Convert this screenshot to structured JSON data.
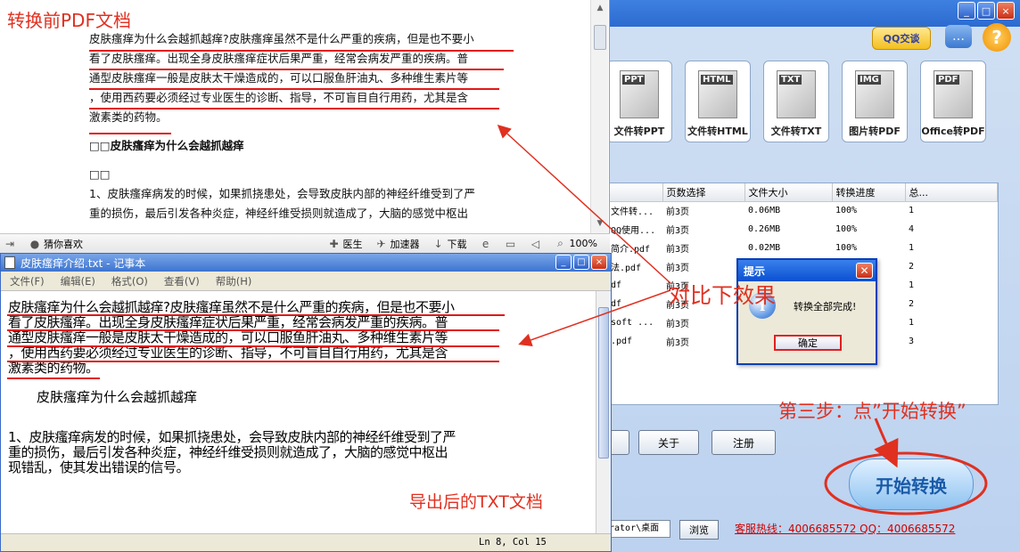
{
  "pdf": {
    "heading": "转换前PDF文档",
    "lines": [
      "皮肤瘙痒为什么会越抓越痒?皮肤瘙痒虽然不是什么严重的疾病，但是也不要小",
      "看了皮肤瘙痒。出现全身皮肤瘙痒症状后果严重，经常会病发严重的疾病。普",
      "通型皮肤瘙痒一般是皮肤太干燥造成的，可以口服鱼肝油丸、多种维生素片等",
      "，使用西药要必须经过专业医生的诊断、指导，不可盲目自行用药，尤其是含",
      "激素类的药物。"
    ],
    "subheading": "□□皮肤瘙痒为什么会越抓越痒",
    "squares": "□□",
    "para_line1": "1、皮肤瘙痒病发的时候，如果抓挠患处，会导致皮肤内部的神经纤维受到了严",
    "para_line2": "重的损伤，最后引发各种炎症，神经纤维受损则就造成了，大脑的感觉中枢出",
    "status": {
      "fav": "猜你喜欢",
      "doctor": "医生",
      "accelerator": "加速器",
      "download": "下载",
      "zoom": "100%"
    }
  },
  "notepad": {
    "title": "皮肤瘙痒介绍.txt - 记事本",
    "menu": [
      "文件(F)",
      "编辑(E)",
      "格式(O)",
      "查看(V)",
      "帮助(H)"
    ],
    "lines": [
      "皮肤瘙痒为什么会越抓越痒?皮肤瘙痒虽然不是什么严重的疾病，但是也不要小",
      "看了皮肤瘙痒。出现全身皮肤瘙痒症状后果严重，经常会病发严重的疾病。普",
      "通型皮肤瘙痒一般是皮肤太干燥造成的，可以口服鱼肝油丸、多种维生素片等",
      "，使用西药要必须经过专业医生的诊断、指导，不可盲目自行用药，尤其是含",
      "激素类的药物。"
    ],
    "heading": "皮肤瘙痒为什么会越抓越痒",
    "para": [
      "1、皮肤瘙痒病发的时候，如果抓挠患处，会导致皮肤内部的神经纤维受到了严",
      "重的损伤，最后引发各种炎症，神经纤维受损则就造成了，大脑的感觉中枢出",
      "现错乱，使其发出错误的信号。"
    ],
    "status_pos": "Ln 8, Col 15",
    "label": "导出后的TXT文档"
  },
  "app": {
    "qq_button": "QQ交谈",
    "tools": [
      {
        "tag": "PPT",
        "label": "文件转PPT"
      },
      {
        "tag": "HTML",
        "label": "文件转HTML"
      },
      {
        "tag": "TXT",
        "label": "文件转TXT"
      },
      {
        "tag": "IMG",
        "label": "图片转PDF"
      },
      {
        "tag": "PDF",
        "label": "Office转PDF"
      }
    ],
    "table": {
      "headers": [
        "",
        "页数选择",
        "文件大小",
        "转换进度",
        "总..."
      ],
      "rows": [
        [
          "文件转...",
          "前3页",
          "0.06MB",
          "100%",
          "1"
        ],
        [
          "QQ使用...",
          "前3页",
          "0.26MB",
          "100%",
          "4"
        ],
        [
          "简介.pdf",
          "前3页",
          "0.02MB",
          "100%",
          "1"
        ],
        [
          "法.pdf",
          "前3页",
          "",
          "",
          "2"
        ],
        [
          "df",
          "前3页",
          "",
          "",
          "1"
        ],
        [
          "df",
          "前3页",
          "",
          "",
          "2"
        ],
        [
          "soft ...",
          "前3页",
          "",
          "",
          "1"
        ],
        [
          ".pdf",
          "前3页",
          "",
          "",
          "3"
        ]
      ]
    },
    "about_button": "关于",
    "register_button": "注册",
    "start_button": "开始转换",
    "path_value": "rator\\桌面",
    "browse_button": "浏览",
    "hotline": "客服热线：4006685572 QQ：4006685572"
  },
  "dialog": {
    "title": "提示",
    "message": "转换全部完成!",
    "ok_button": "确定"
  },
  "annotations": {
    "compare": "对比下效果",
    "step3": "第三步：点”开始转换”"
  },
  "colors": {
    "annotation_red": "#e03020",
    "underline_red": "#e01818"
  }
}
